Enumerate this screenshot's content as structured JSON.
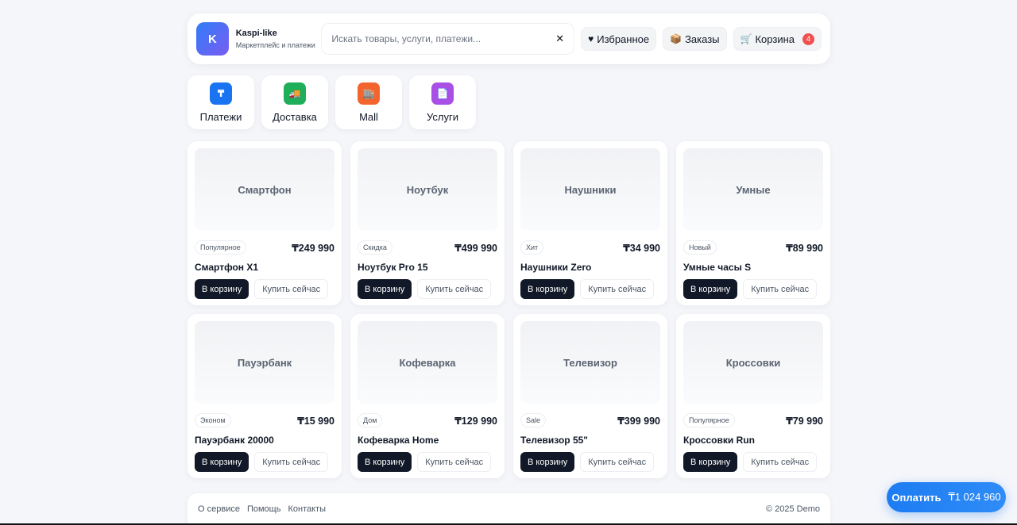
{
  "header": {
    "logo_letter": "K",
    "brand_name": "Kaspi-like",
    "brand_sub": "Маркетплейс и платежи",
    "search_placeholder": "Искать товары, услуги, платежи...",
    "clear_icon": "✕",
    "favorites_label": "Избранное",
    "orders_label": "Заказы",
    "cart_label": "Корзина",
    "cart_count": "4"
  },
  "categories": [
    {
      "label": "Платежи",
      "icon": "₸",
      "color": "#1a73f0"
    },
    {
      "label": "Доставка",
      "icon": "🚚",
      "color": "#1fae5a"
    },
    {
      "label": "Mall",
      "icon": "🏬",
      "color": "#f2652e"
    },
    {
      "label": "Услуги",
      "icon": "📄",
      "color": "#a84fe6"
    }
  ],
  "products": [
    {
      "thumb": "Смартфон",
      "tag": "Популярное",
      "price": "₸249 990",
      "name": "Смартфон X1"
    },
    {
      "thumb": "Ноутбук",
      "tag": "Скидка",
      "price": "₸499 990",
      "name": "Ноутбук Pro 15"
    },
    {
      "thumb": "Наушники",
      "tag": "Хит",
      "price": "₸34 990",
      "name": "Наушники Zero"
    },
    {
      "thumb": "Умные",
      "tag": "Новый",
      "price": "₸89 990",
      "name": "Умные часы S"
    },
    {
      "thumb": "Пауэрбанк",
      "tag": "Эконом",
      "price": "₸15 990",
      "name": "Пауэрбанк 20000"
    },
    {
      "thumb": "Кофеварка",
      "tag": "Дом",
      "price": "₸129 990",
      "name": "Кофеварка Home"
    },
    {
      "thumb": "Телевизор",
      "tag": "Sale",
      "price": "₸399 990",
      "name": "Телевизор 55\""
    },
    {
      "thumb": "Кроссовки",
      "tag": "Популярное",
      "price": "₸79 990",
      "name": "Кроссовки Run"
    }
  ],
  "product_actions": {
    "cart_button": "В корзину",
    "buy_button": "Купить сейчас"
  },
  "footer": {
    "links": [
      "О сервисе",
      "Помощь",
      "Контакты"
    ],
    "copyright": "© 2025 Demo"
  },
  "pay": {
    "label": "Оплатить",
    "amount": "₸1 024 960"
  }
}
